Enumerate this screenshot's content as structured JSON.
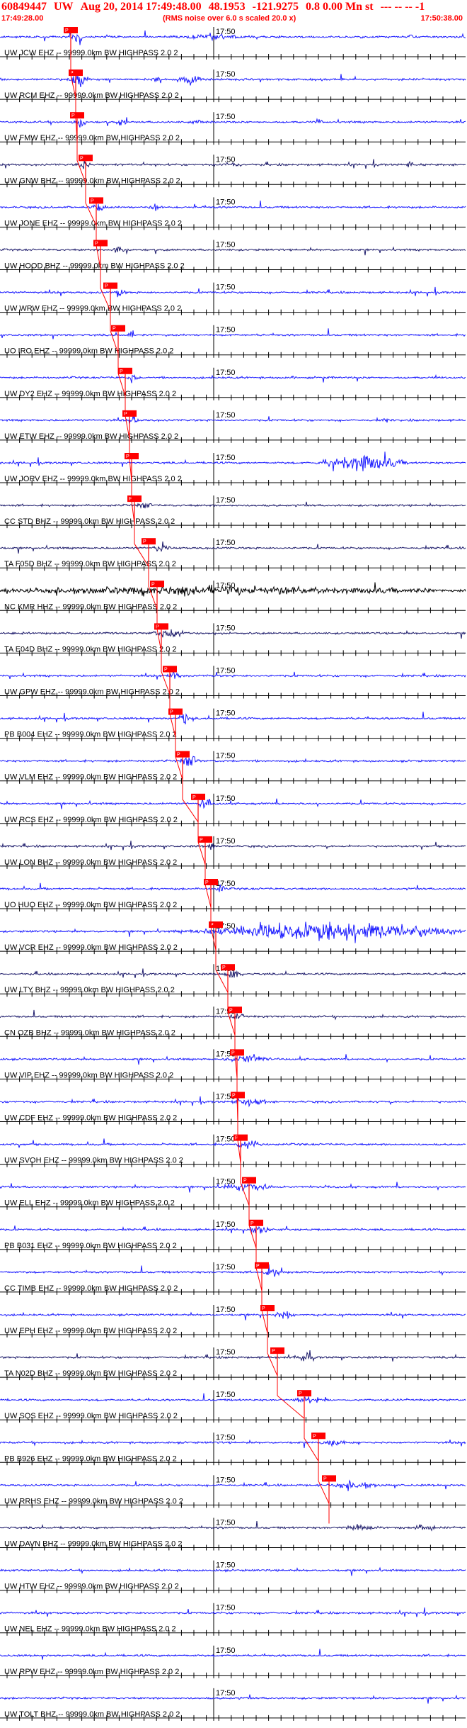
{
  "header": {
    "event_id": "60849447",
    "network": "UW",
    "datetime": "Aug 20, 2014 17:49:48.00",
    "lat": "48.1953",
    "lon": "-121.9275",
    "mag_depth": "0.8 0.00 Mn st",
    "tail": "--- -- --  -1",
    "start_time": "17:49:28.00",
    "end_time": "17:50:38.00",
    "noise_note": "(RMS noise over 6.0 s scaled 20.0 x)"
  },
  "colors": {
    "header_text": "#ff0000",
    "trace_blue": "#1a1aff",
    "trace_dark": "#1c1a6a",
    "trace_black": "#000000",
    "pick": "#ff0000",
    "baseline": "#000000"
  },
  "chart_data": {
    "type": "seismogram-record-section",
    "time_axis": {
      "start": "17:49:28.00",
      "end": "17:50:38.00",
      "minute_mark_label": "17:50"
    },
    "traces": [
      {
        "label": "UW JCW EHZ -- 99999.0km BW  HIGHPASS  2.0  2",
        "color": "blue",
        "pick": "P"
      },
      {
        "label": "UW RCM EHZ -- 99999.0km BW  HIGHPASS  2.0  2",
        "color": "blue",
        "pick": "P"
      },
      {
        "label": "UW FMW EHZ -- 99999.0km BW  HIGHPASS  2.0  2",
        "color": "blue",
        "pick": "P"
      },
      {
        "label": "UW GNW BHZ -- 99999.0km BW  HIGHPASS  2.0  2",
        "color": "dark",
        "pick": "P"
      },
      {
        "label": "UW JONE EHZ -- 99999.0km BW  HIGHPASS  2.0  2",
        "color": "blue",
        "pick": "P"
      },
      {
        "label": "UW HOOD BHZ -- 99999.0km BW  HIGHPASS  2.0  2",
        "color": "dark",
        "pick": "P"
      },
      {
        "label": "UW WRW EHZ -- 99999.0km BW  HIGHPASS  2.0  2",
        "color": "blue",
        "pick": "P"
      },
      {
        "label": "UO IRO EHZ -- 99999.0km BW  HIGHPASS  2.0  2",
        "color": "blue",
        "pick": "P"
      },
      {
        "label": "UW DY2 EHZ -- 99999.0km BW  HIGHPASS  2.0  2",
        "color": "blue",
        "pick": "P"
      },
      {
        "label": "UW ETW EHZ -- 99999.0km BW  HIGHPASS  2.0  2",
        "color": "blue",
        "pick": "P"
      },
      {
        "label": "UW JORV EHZ -- 99999.0km BW  HIGHPASS  2.0  2",
        "color": "blue",
        "pick": "P"
      },
      {
        "label": "CC STD BHZ -- 99999.0km BW  HIGHPASS  2.0  2",
        "color": "dark",
        "pick": "P"
      },
      {
        "label": "TA F05D BHZ -- 99999.0km BW  HIGHPASS  2.0  2",
        "color": "dark",
        "pick": "P"
      },
      {
        "label": "NC KMR HHZ -- 99999.0km BW  HIGHPASS  2.0  2",
        "color": "black",
        "pick": "P"
      },
      {
        "label": "TA E04D BHZ -- 99999.0km BW  HIGHPASS  2.0  2",
        "color": "dark",
        "pick": "P"
      },
      {
        "label": "UW GPW EHZ -- 99999.0km BW  HIGHPASS  2.0  2",
        "color": "blue",
        "pick": "P"
      },
      {
        "label": "PB B004 EHZ -- 99999.0km BW  HIGHPASS  2.0  2",
        "color": "blue",
        "pick": "P"
      },
      {
        "label": "UW VLM EHZ -- 99999.0km BW  HIGHPASS  2.0  2",
        "color": "blue",
        "pick": "P"
      },
      {
        "label": "UW RCS EHZ -- 99999.0km BW  HIGHPASS  2.0  2",
        "color": "blue",
        "pick": "P"
      },
      {
        "label": "UW LON BHZ -- 99999.0km BW  HIGHPASS  2.0  2",
        "color": "dark",
        "pick": "P"
      },
      {
        "label": "UO HUO EHZ -- 99999.0km BW  HIGHPASS  2.0  2",
        "color": "blue",
        "pick": "P"
      },
      {
        "label": "UW VCR EHZ -- 99999.0km BW  HIGHPASS  2.0  2",
        "color": "blue",
        "pick": "P"
      },
      {
        "label": "UW LTY BHZ -- 99999.0km BW  HIGHPASS  2.0  2",
        "color": "dark",
        "pick": "P"
      },
      {
        "label": "CN OZB BHZ -- 99999.0km BW  HIGHPASS  2.0  2",
        "color": "dark",
        "pick": "P"
      },
      {
        "label": "UW VIP EHZ -- 99999.0km BW  HIGHPASS  2.0  2",
        "color": "blue",
        "pick": "P"
      },
      {
        "label": "UW CDF EHZ -- 99999.0km BW  HIGHPASS  2.0  2",
        "color": "blue",
        "pick": "P"
      },
      {
        "label": "UW SVOH EHZ -- 99999.0km BW  HIGHPASS  2.0  2",
        "color": "blue",
        "pick": "P"
      },
      {
        "label": "UW ELL EHZ -- 99999.0km BW  HIGHPASS  2.0  2",
        "color": "blue",
        "pick": "P"
      },
      {
        "label": "PB B031 EHZ -- 99999.0km BW  HIGHPASS  2.0  2",
        "color": "blue",
        "pick": "P"
      },
      {
        "label": "CC TIMB EHZ -- 99999.0km BW  HIGHPASS  2.0  2",
        "color": "blue",
        "pick": "P"
      },
      {
        "label": "UW EPH EHZ -- 99999.0km BW  HIGHPASS  2.0  2",
        "color": "blue",
        "pick": "P"
      },
      {
        "label": "TA N02D BHZ -- 99999.0km BW  HIGHPASS  2.0  2",
        "color": "dark",
        "pick": "P"
      },
      {
        "label": "UW SQS EHZ -- 99999.0km BW  HIGHPASS  2.0  2",
        "color": "blue",
        "pick": "P"
      },
      {
        "label": "PB B926 EHZ -- 99999.0km BW  HIGHPASS  2.0  2",
        "color": "blue",
        "pick": "P"
      },
      {
        "label": "UW RRHS EHZ -- 99999.0km BW  HIGHPASS  2.0  2",
        "color": "blue",
        "pick": "P"
      },
      {
        "label": "UW DAVN BHZ -- 99999.0km BW  HIGHPASS  2.0  2",
        "color": "dark",
        "pick": ""
      },
      {
        "label": "UW HTW EHZ -- 99999.0km BW  HIGHPASS  2.0  2",
        "color": "blue",
        "pick": ""
      },
      {
        "label": "UW NEL EHZ -- 99999.0km BW  HIGHPASS  2.0  2",
        "color": "blue",
        "pick": ""
      },
      {
        "label": "UW RPW EHZ -- 99999.0km BW  HIGHPASS  2.0  2",
        "color": "blue",
        "pick": ""
      },
      {
        "label": "UW TOLT BHZ -- 99999.0km BW  HIGHPASS  2.0  2",
        "color": "blue",
        "pick": ""
      }
    ]
  }
}
